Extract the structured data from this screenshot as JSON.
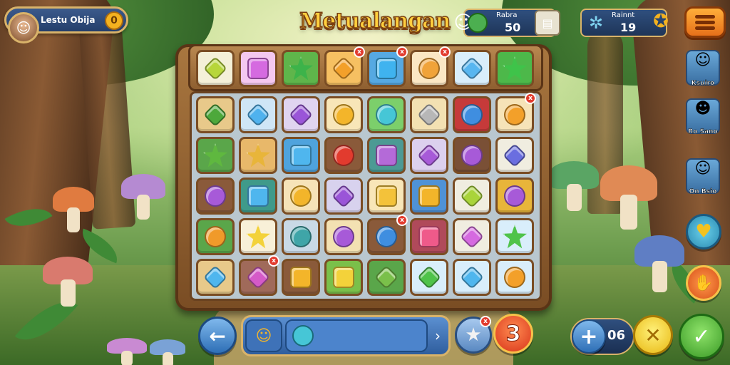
{
  "player": {
    "name": "Lestu Obija",
    "coin_label": "0"
  },
  "title": "Metualangan",
  "stats": [
    {
      "label": "Rabra",
      "value": "50",
      "icon": "gem-icon",
      "color": "#4caf50"
    },
    {
      "label": "Rainnt",
      "value": "19",
      "icon": "butterfly-icon",
      "color": "#7fd3f0"
    }
  ],
  "top_row": [
    {
      "shape": "diamond",
      "color": "#b7d63a",
      "tile": "#f4f0d8",
      "badge": ""
    },
    {
      "shape": "square",
      "color": "#d56ae0",
      "tile": "#f4c8f0",
      "badge": ""
    },
    {
      "shape": "star",
      "color": "#3db34a",
      "tile": "#5fb54b",
      "badge": ""
    },
    {
      "shape": "diamond",
      "color": "#f3a02a",
      "tile": "#f6c062",
      "badge": "x"
    },
    {
      "shape": "square",
      "color": "#3fb3ef",
      "tile": "#56a9e2",
      "badge": "x"
    },
    {
      "shape": "round",
      "color": "#f0a33a",
      "tile": "#fbe7c4",
      "badge": "x"
    },
    {
      "shape": "diamond",
      "color": "#58b6f0",
      "tile": "#d9eefb",
      "badge": ""
    },
    {
      "shape": "star",
      "color": "#3fc34a",
      "tile": "#4db84a",
      "badge": ""
    }
  ],
  "grid": [
    [
      {
        "shape": "diamond",
        "color": "#4da83b",
        "tile": "#e8c98a",
        "badge": ""
      },
      {
        "shape": "diamond",
        "color": "#4fb2ee",
        "tile": "#cfe6f6",
        "badge": ""
      },
      {
        "shape": "diamond",
        "color": "#9a55d8",
        "tile": "#e0d4f0",
        "badge": ""
      },
      {
        "shape": "round",
        "color": "#f3b52a",
        "tile": "#f8e6b8",
        "badge": ""
      },
      {
        "shape": "round",
        "color": "#46c6d6",
        "tile": "#7ccf6b",
        "badge": ""
      },
      {
        "shape": "diamond",
        "color": "#b7b7b7",
        "tile": "#f3e1b2",
        "badge": ""
      },
      {
        "shape": "round",
        "color": "#3f8ee0",
        "tile": "#c63a3a",
        "badge": ""
      },
      {
        "shape": "round",
        "color": "#f3a02a",
        "tile": "#f6e3b8",
        "badge": "x"
      }
    ],
    [
      {
        "shape": "star",
        "color": "#5fb83f",
        "tile": "#5aa64a",
        "badge": ""
      },
      {
        "shape": "star",
        "color": "#e8b53a",
        "tile": "#e8b86a",
        "badge": ""
      },
      {
        "shape": "square",
        "color": "#4fb6ee",
        "tile": "#4fa3dd",
        "badge": ""
      },
      {
        "shape": "round",
        "color": "#e23b2e",
        "tile": "#8a5a3a",
        "badge": ""
      },
      {
        "shape": "square",
        "color": "#b46ad8",
        "tile": "#4c9a94",
        "badge": ""
      },
      {
        "shape": "diamond",
        "color": "#a75ad8",
        "tile": "#dcd0ee",
        "badge": ""
      },
      {
        "shape": "round",
        "color": "#a75ad8",
        "tile": "#7a5036",
        "badge": ""
      },
      {
        "shape": "diamond",
        "color": "#6a6ee0",
        "tile": "#f0ede0",
        "badge": ""
      }
    ],
    [
      {
        "shape": "round",
        "color": "#a75ad8",
        "tile": "#8a5a3a",
        "badge": ""
      },
      {
        "shape": "square",
        "color": "#4fb6ee",
        "tile": "#3f9a8a",
        "badge": ""
      },
      {
        "shape": "round",
        "color": "#f3b52a",
        "tile": "#f6e3b8",
        "badge": ""
      },
      {
        "shape": "diamond",
        "color": "#9a55d8",
        "tile": "#d8d2ee",
        "badge": ""
      },
      {
        "shape": "square",
        "color": "#f3c23a",
        "tile": "#f8e6b8",
        "badge": ""
      },
      {
        "shape": "square",
        "color": "#f3b52a",
        "tile": "#4f92d6",
        "badge": ""
      },
      {
        "shape": "diamond",
        "color": "#a9d43a",
        "tile": "#f0ede0",
        "badge": ""
      },
      {
        "shape": "round",
        "color": "#a75ad8",
        "tile": "#e8b53a",
        "badge": ""
      }
    ],
    [
      {
        "shape": "round",
        "color": "#f09a2a",
        "tile": "#5aa64a",
        "badge": ""
      },
      {
        "shape": "star",
        "color": "#f3d23a",
        "tile": "#f8f0d8",
        "badge": ""
      },
      {
        "shape": "round",
        "color": "#3fa5a8",
        "tile": "#c9d9e6",
        "badge": ""
      },
      {
        "shape": "round",
        "color": "#a75ad8",
        "tile": "#f3e1b2",
        "badge": ""
      },
      {
        "shape": "round",
        "color": "#3f8ee0",
        "tile": "#8a5a3a",
        "badge": "x"
      },
      {
        "shape": "square",
        "color": "#ef5a8a",
        "tile": "#b04a5a",
        "badge": ""
      },
      {
        "shape": "diamond",
        "color": "#d56ae0",
        "tile": "#f0ede0",
        "badge": ""
      },
      {
        "shape": "star",
        "color": "#4fc34a",
        "tile": "#d9eefb",
        "badge": ""
      }
    ],
    [
      {
        "shape": "diamond",
        "color": "#4fb6ee",
        "tile": "#e8c98a",
        "badge": ""
      },
      {
        "shape": "diamond",
        "color": "#d55ac8",
        "tile": "#a06a5a",
        "badge": "x"
      },
      {
        "shape": "square",
        "color": "#f3b52a",
        "tile": "#8a5a3a",
        "badge": ""
      },
      {
        "shape": "square",
        "color": "#f3d23a",
        "tile": "#7ac04a",
        "badge": ""
      },
      {
        "shape": "diamond",
        "color": "#7ac04a",
        "tile": "#5aa64a",
        "badge": ""
      },
      {
        "shape": "diamond",
        "color": "#4fc34a",
        "tile": "#d9eefb",
        "badge": ""
      },
      {
        "shape": "diamond",
        "color": "#4fb6ee",
        "tile": "#d9eefb",
        "badge": ""
      },
      {
        "shape": "round",
        "color": "#f3a02a",
        "tile": "#d9eefb",
        "badge": ""
      }
    ]
  ],
  "side_characters": [
    {
      "name": "Ksuiro",
      "icon": "explorer-icon"
    },
    {
      "name": "Ro Sano",
      "icon": "girl-icon"
    },
    {
      "name": "On Bsio",
      "icon": "hat-explorer-icon"
    }
  ],
  "bottom": {
    "count": "3",
    "plus_value": "06",
    "back_icon": "arrow-left-icon",
    "next_icon": "chevron-right-icon"
  },
  "colors": {
    "accent": "#d9b36a",
    "panel": "#2f4f7e",
    "title": "#ffcf3e"
  }
}
